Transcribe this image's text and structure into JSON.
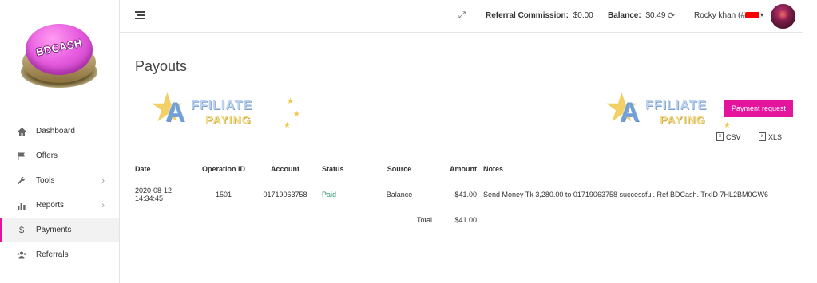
{
  "sidebar": {
    "logo_text": "BDCASH",
    "items": [
      {
        "label": "Dashboard",
        "icon": "home-icon"
      },
      {
        "label": "Offers",
        "icon": "flag-icon"
      },
      {
        "label": "Tools",
        "icon": "wrench-icon"
      },
      {
        "label": "Reports",
        "icon": "bar-chart-icon"
      },
      {
        "label": "Payments",
        "icon": "dollar-icon"
      },
      {
        "label": "Referrals",
        "icon": "users-icon"
      }
    ],
    "active_item": "Payments",
    "accent_color": "#e5149d"
  },
  "topbar": {
    "referral_label": "Referral Commission:",
    "referral_value": "$0.00",
    "balance_label": "Balance:",
    "balance_value": "$0.49",
    "user_name": "Rocky khan (#"
  },
  "page": {
    "title": "Payouts",
    "watermark_line1": "FFILIATE",
    "watermark_line2": "PAYING",
    "watermark_letter": "A",
    "payment_request_label": "Payment request",
    "export_csv_label": "CSV",
    "export_xls_label": "XLS"
  },
  "table": {
    "headers": [
      "Date",
      "Operation ID",
      "Account",
      "Status",
      "Source",
      "Amount",
      "Notes"
    ],
    "rows": [
      {
        "date_line1": "2020-08-12",
        "date_line2": "14:34:45",
        "operation_id": "1501",
        "account": "01719063758",
        "status": "Paid",
        "source": "Balance",
        "amount": "$41.00",
        "notes": "Send Money Tk 3,280.00 to 01719063758 successful. Ref BDCash. TrxID 7HL2BM0GW6"
      }
    ],
    "total_label": "Total",
    "total_value": "$41.00"
  }
}
